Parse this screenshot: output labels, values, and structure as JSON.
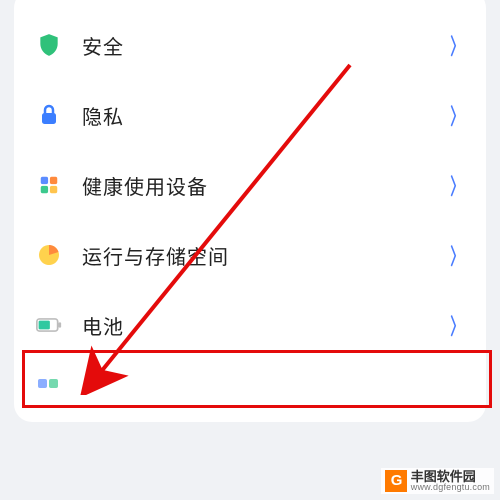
{
  "settings": {
    "rows": [
      {
        "label": "安全",
        "icon": "shield"
      },
      {
        "label": "隐私",
        "icon": "lock"
      },
      {
        "label": "健康使用设备",
        "icon": "blocks"
      },
      {
        "label": "运行与存储空间",
        "icon": "piechart"
      },
      {
        "label": "电池",
        "icon": "battery"
      }
    ]
  },
  "watermark": {
    "brand_char": "G",
    "title": "丰图软件园",
    "url": "www.dgfengtu.com"
  }
}
